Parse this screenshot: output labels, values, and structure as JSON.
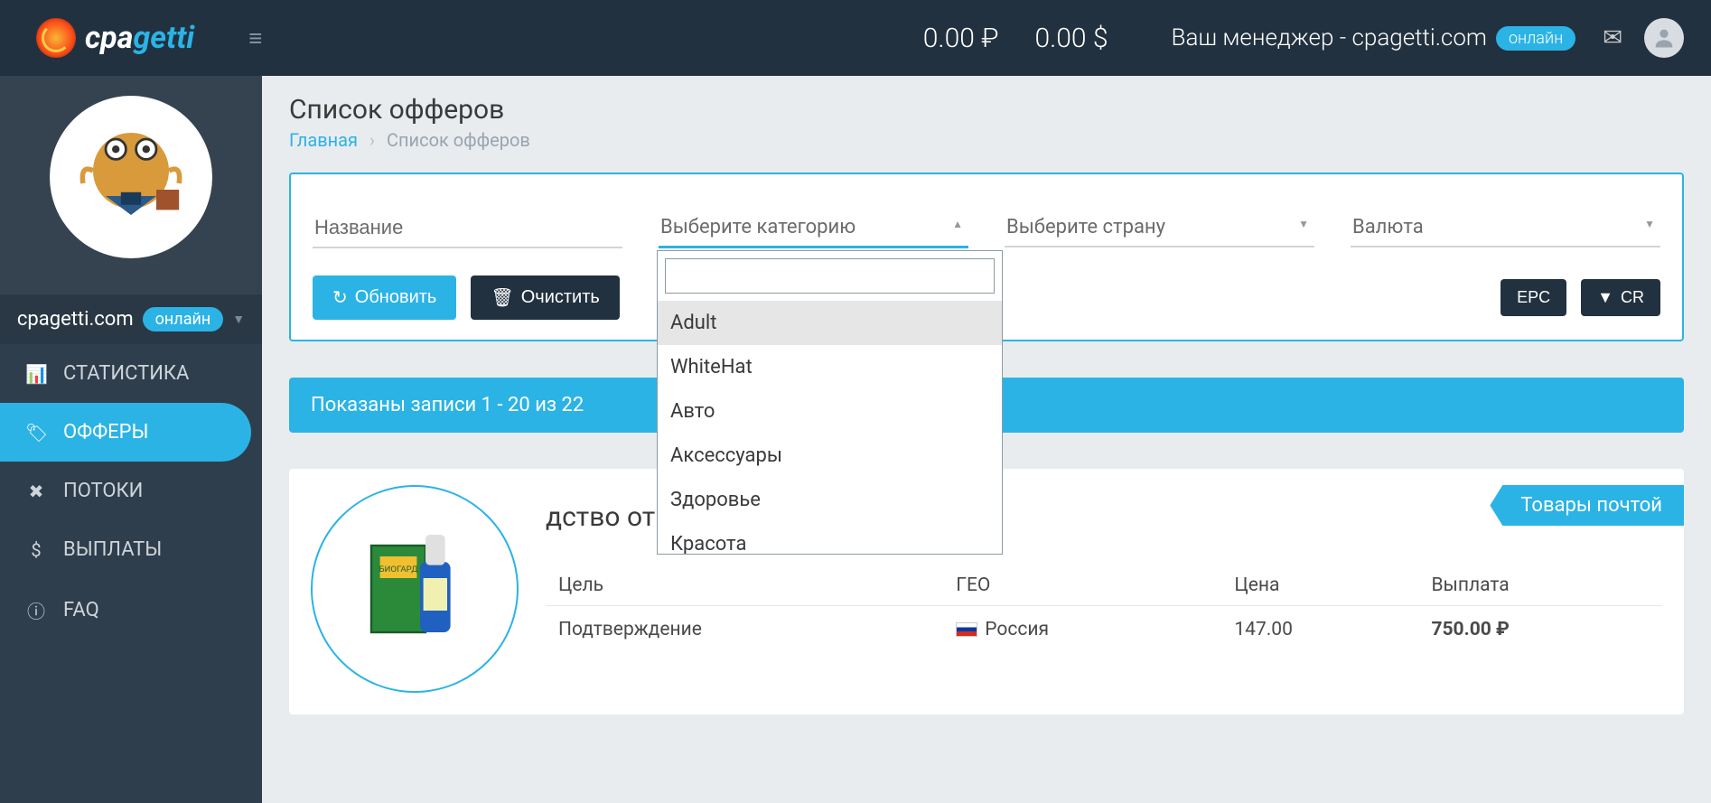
{
  "header": {
    "logo_text_cpa": "cpa",
    "logo_text_getti": "getti",
    "balance_rub": "0.00 ₽",
    "balance_usd": "0.00 $",
    "manager_label": "Ваш менеджер - cpagetti.com",
    "online_badge": "онлайн"
  },
  "sidebar": {
    "profile_name": "cpagetti.com",
    "profile_online": "онлайн",
    "items": [
      {
        "label": "СТАТИСТИКА",
        "icon": "📊"
      },
      {
        "label": "ОФФЕРЫ",
        "icon": "🏷"
      },
      {
        "label": "ПОТОКИ",
        "icon": "✖"
      },
      {
        "label": "ВЫПЛАТЫ",
        "icon": "$"
      },
      {
        "label": "FAQ",
        "icon": "ⓘ"
      }
    ]
  },
  "page": {
    "title": "Список офферов",
    "breadcrumb_home": "Главная",
    "breadcrumb_current": "Список офферов"
  },
  "filters": {
    "name_placeholder": "Название",
    "category_placeholder": "Выберите категорию",
    "country_placeholder": "Выберите страну",
    "currency_placeholder": "Валюта",
    "refresh_label": "Обновить",
    "clear_label": "Очистить",
    "epc_label": "EPC",
    "cr_label": "CR",
    "category_options": [
      "Adult",
      "WhiteHat",
      "Авто",
      "Аксессуары",
      "Здоровье",
      "Красота"
    ]
  },
  "records_bar": "Показаны записи 1 - 20 из 22",
  "offer": {
    "title_partial": "дство от сорняков",
    "tag": "Товары почтой",
    "columns": {
      "goal": "Цель",
      "geo": "ГЕО",
      "price": "Цена",
      "payout": "Выплата"
    },
    "row": {
      "goal": "Подтверждение",
      "geo": "Россия",
      "price": "147.00",
      "payout": "750.00 ₽"
    }
  }
}
